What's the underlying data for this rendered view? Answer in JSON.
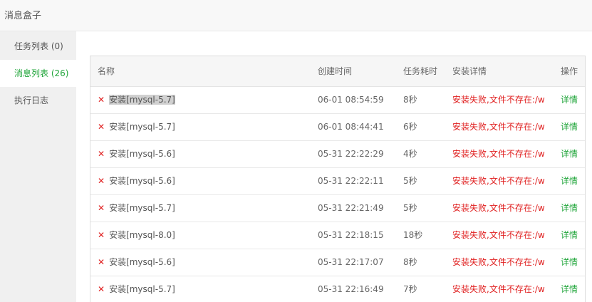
{
  "window": {
    "title": "消息盒子"
  },
  "sidebar": {
    "items": [
      {
        "label": "任务列表 (0)"
      },
      {
        "label": "消息列表 (26)"
      },
      {
        "label": "执行日志"
      }
    ]
  },
  "table": {
    "headers": {
      "name": "名称",
      "created": "创建时间",
      "duration": "任务耗时",
      "detail": "安装详情",
      "action": "操作"
    },
    "rows": [
      {
        "name": "安装[mysql-5.7]",
        "created": "06-01 08:54:59",
        "duration": "8秒",
        "detail": "安装失败,文件不存在:/www",
        "action": "详情"
      },
      {
        "name": "安装[mysql-5.7]",
        "created": "06-01 08:44:41",
        "duration": "6秒",
        "detail": "安装失败,文件不存在:/www",
        "action": "详情"
      },
      {
        "name": "安装[mysql-5.6]",
        "created": "05-31 22:22:29",
        "duration": "4秒",
        "detail": "安装失败,文件不存在:/www",
        "action": "详情"
      },
      {
        "name": "安装[mysql-5.6]",
        "created": "05-31 22:22:11",
        "duration": "5秒",
        "detail": "安装失败,文件不存在:/www",
        "action": "详情"
      },
      {
        "name": "安装[mysql-5.7]",
        "created": "05-31 22:21:49",
        "duration": "5秒",
        "detail": "安装失败,文件不存在:/www",
        "action": "详情"
      },
      {
        "name": "安装[mysql-8.0]",
        "created": "05-31 22:18:15",
        "duration": "18秒",
        "detail": "安装失败,文件不存在:/www",
        "action": "详情"
      },
      {
        "name": "安装[mysql-5.6]",
        "created": "05-31 22:17:07",
        "duration": "8秒",
        "detail": "安装失败,文件不存在:/www",
        "action": "详情"
      },
      {
        "name": "安装[mysql-5.7]",
        "created": "05-31 22:16:49",
        "duration": "7秒",
        "detail": "安装失败,文件不存在:/www",
        "action": "详情"
      }
    ]
  },
  "icons": {
    "status_failed": "close-icon"
  },
  "colors": {
    "accent": "#20a53a",
    "error": "#e02020"
  }
}
